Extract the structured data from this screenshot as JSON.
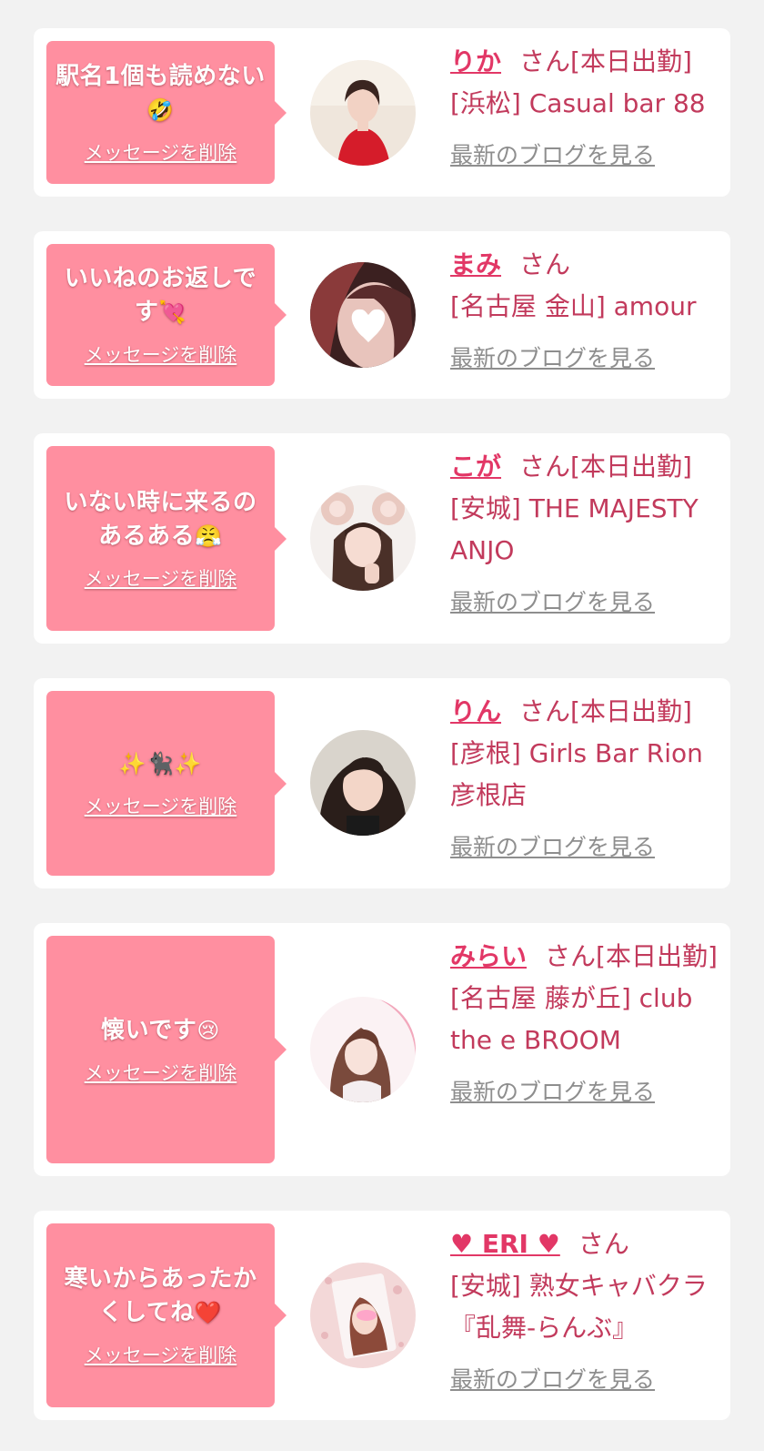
{
  "cards": [
    {
      "message": "駅名1個も読めない",
      "message_emoji": "🤣",
      "delete_label": "メッセージを削除",
      "name": "りか",
      "honorific": "さん[本日出勤]",
      "shop": "[浜松] Casual bar 88",
      "blog_label": "最新のブログを見る"
    },
    {
      "message": "いいねのお返しです",
      "message_emoji": "💘",
      "delete_label": "メッセージを削除",
      "name": "まみ",
      "honorific": "さん",
      "shop": "[名古屋 金山] amour",
      "blog_label": "最新のブログを見る"
    },
    {
      "message": "いない時に来るのあるある",
      "message_emoji": "😤",
      "delete_label": "メッセージを削除",
      "name": "こが",
      "honorific": "さん[本日出勤]",
      "shop": "[安城] THE MAJESTY ANJO",
      "blog_label": "最新のブログを見る"
    },
    {
      "message": "",
      "message_emoji": "✨🐈‍⬛✨",
      "delete_label": "メッセージを削除",
      "name": "りん",
      "honorific": "さん[本日出勤]",
      "shop": "[彦根] Girls Bar Rion 彦根店",
      "blog_label": "最新のブログを見る"
    },
    {
      "message": "懐いです",
      "message_emoji": "😢",
      "delete_label": "メッセージを削除",
      "name": "みらい",
      "honorific": "さん[本日出勤]",
      "shop": "[名古屋 藤が丘] club the e BROOM",
      "blog_label": "最新のブログを見る"
    },
    {
      "message": "寒いからあったかくしてね",
      "message_emoji": "❤️",
      "delete_label": "メッセージを削除",
      "name": "♥ ERI ♥",
      "honorific": "さん",
      "shop": "[安城] 熟女キャバクラ『乱舞-らんぶ』",
      "blog_label": "最新のブログを見る"
    }
  ],
  "avatar_icons": [
    "avatar-photo-icon",
    "avatar-photo-icon",
    "avatar-photo-icon",
    "avatar-photo-icon",
    "avatar-photo-icon",
    "avatar-photo-icon"
  ],
  "colors": {
    "page_bg": "#f2f2f2",
    "bubble_bg": "#ff8fa0",
    "name_link": "#e23766",
    "shop_text": "#c23a5c",
    "blog_link": "#8e8e8e"
  }
}
